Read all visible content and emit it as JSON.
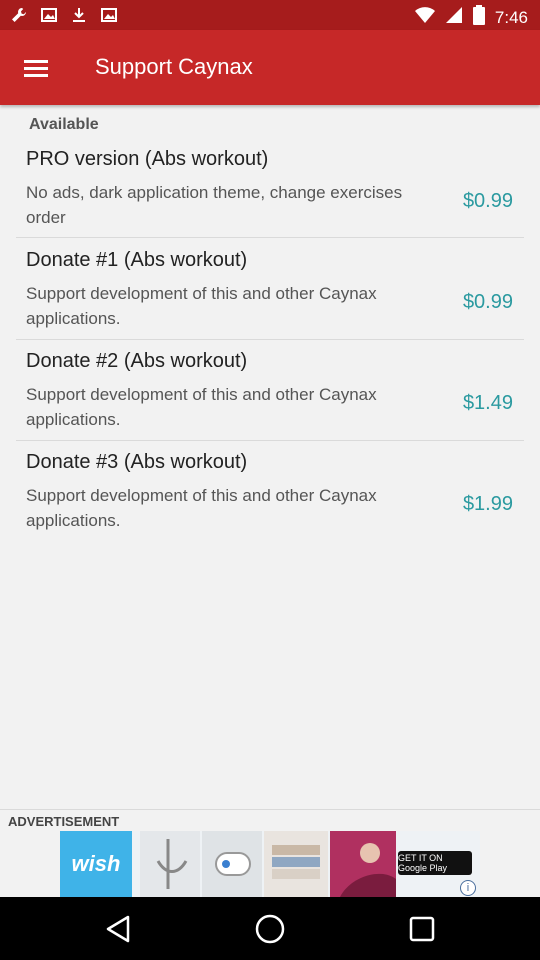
{
  "status_bar": {
    "time": "7:46",
    "icons": [
      "wrench-icon",
      "image-icon",
      "download-icon",
      "image-icon",
      "wifi-icon",
      "signal-icon",
      "battery-icon"
    ]
  },
  "app_bar": {
    "title": "Support Caynax",
    "menu_icon": "hamburger-menu-icon",
    "color": "#c62828"
  },
  "section": {
    "header": "Available"
  },
  "items": [
    {
      "title": "PRO version (Abs workout)",
      "description": "No ads, dark application theme, change exercises order",
      "price": "$0.99"
    },
    {
      "title": "Donate #1 (Abs workout)",
      "description": "Support development of this and other Caynax applications.",
      "price": "$0.99"
    },
    {
      "title": "Donate #2 (Abs workout)",
      "description": "Support development of this and other Caynax applications.",
      "price": "$1.49"
    },
    {
      "title": "Donate #3 (Abs workout)",
      "description": "Support development of this and other Caynax applications.",
      "price": "$1.99"
    }
  ],
  "ad": {
    "label": "ADVERTISEMENT",
    "brand": "wish",
    "badge": "GET IT ON Google Play"
  },
  "nav_bar": {
    "icons": [
      "back-icon",
      "home-icon",
      "recents-icon"
    ]
  },
  "colors": {
    "price": "#2b9aa0",
    "status_bar": "#a61c1c"
  }
}
